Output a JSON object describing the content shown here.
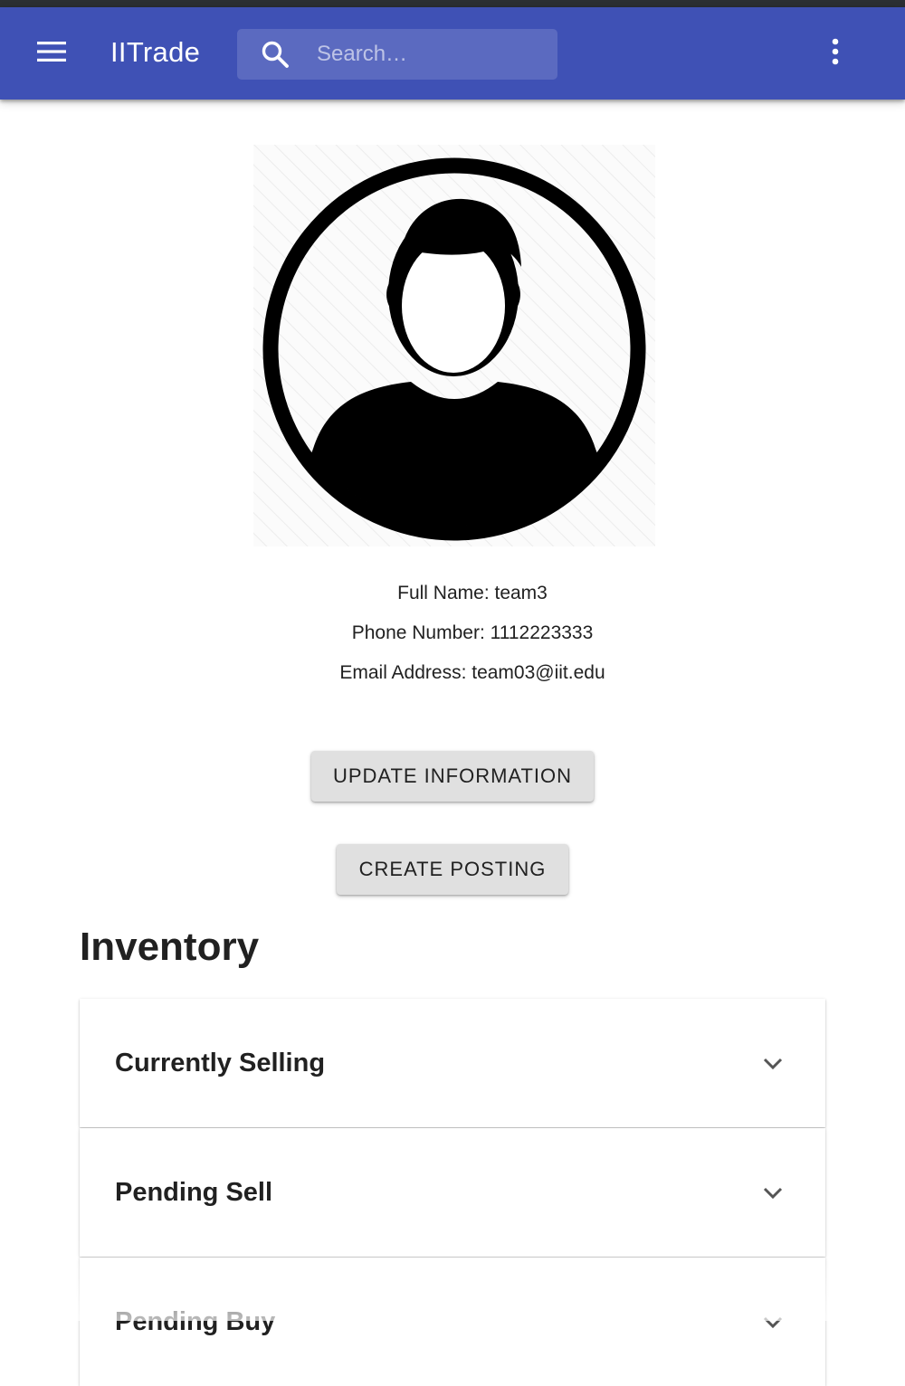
{
  "app": {
    "title": "IITrade",
    "search_placeholder": "Search…",
    "accent_color": "#3f51b5",
    "icons": {
      "menu": "hamburger-menu-icon",
      "search": "search-icon",
      "more": "more-vert-icon"
    }
  },
  "profile": {
    "avatar_icon": "user-avatar-icon",
    "full_name": "Full Name: team3",
    "phone": "Phone Number: 1112223333",
    "email": "Email Address: team03@iit.edu"
  },
  "actions": {
    "update_label": "UPDATE INFORMATION",
    "create_label": "CREATE POSTING"
  },
  "inventory": {
    "heading": "Inventory",
    "panels": [
      {
        "label": "Currently Selling",
        "icon": "chevron-down-icon"
      },
      {
        "label": "Pending Sell",
        "icon": "chevron-down-icon"
      },
      {
        "label": "Pending Buy",
        "icon": "chevron-down-icon"
      }
    ]
  }
}
